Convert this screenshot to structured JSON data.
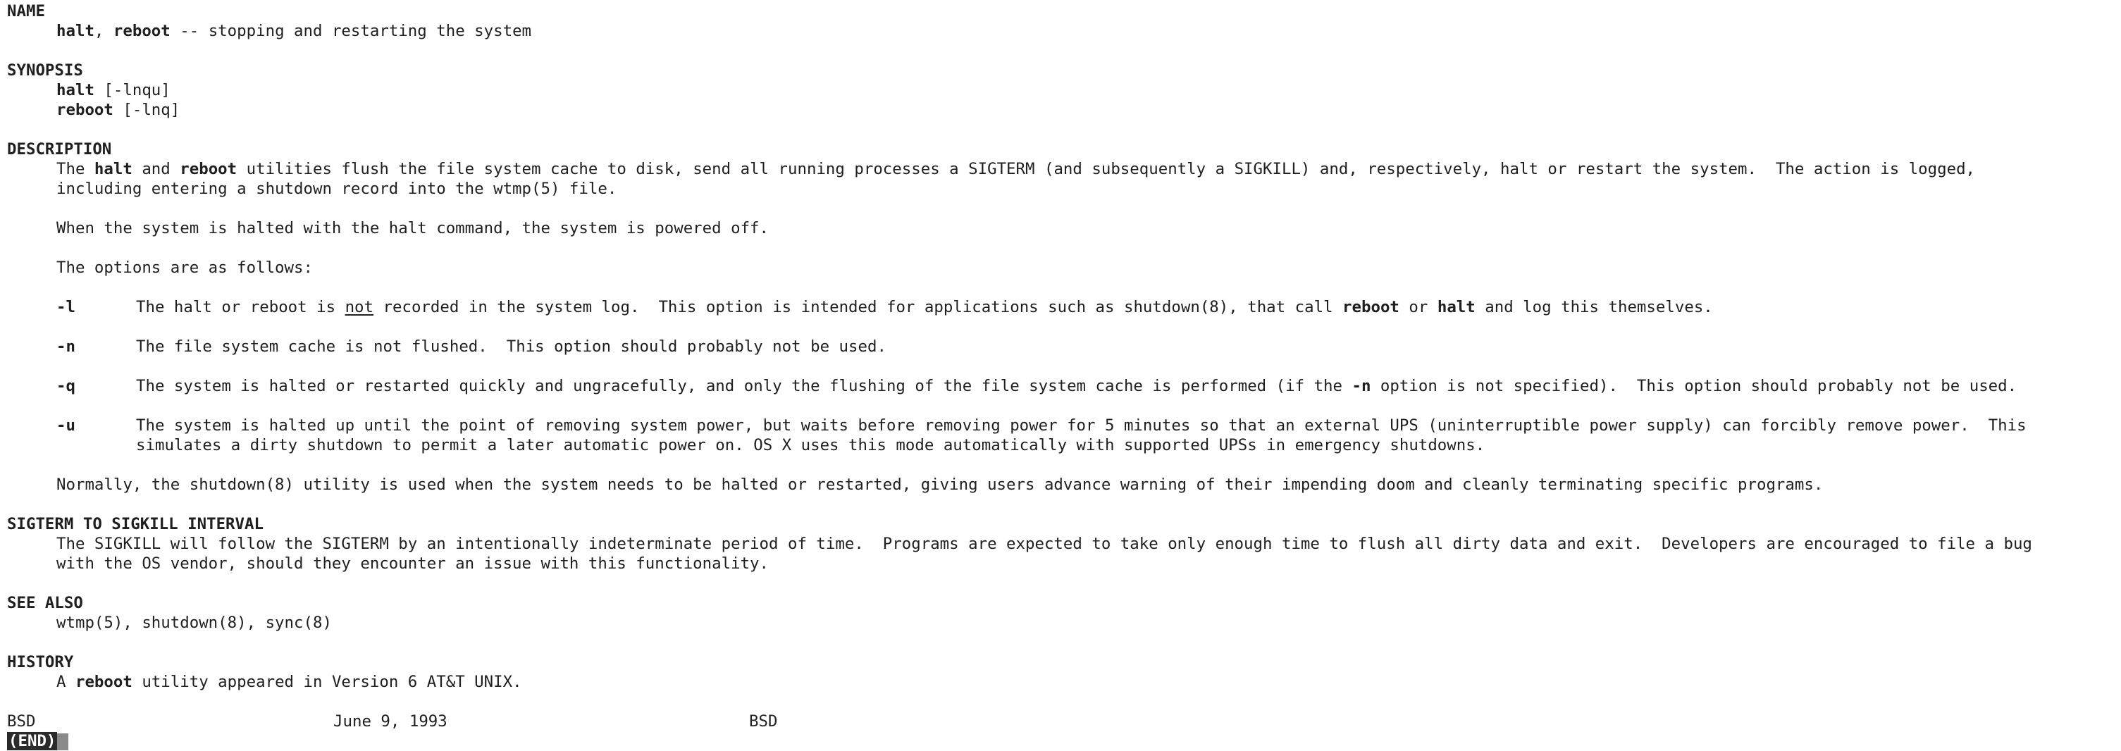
{
  "sections": {
    "name": "NAME",
    "synopsis": "SYNOPSIS",
    "description": "DESCRIPTION",
    "interval": "SIGTERM TO SIGKILL INTERVAL",
    "see_also": "SEE ALSO",
    "history": "HISTORY"
  },
  "name": {
    "cmd1": "halt",
    "sep": ", ",
    "cmd2": "reboot",
    "desc": " -- stopping and restarting the system"
  },
  "synopsis": {
    "halt_cmd": "halt",
    "halt_args": " [-lnqu]",
    "reboot_cmd": "reboot",
    "reboot_args": " [-lnq]"
  },
  "description": {
    "p1_a": "The ",
    "p1_halt": "halt",
    "p1_b": " and ",
    "p1_reboot": "reboot",
    "p1_c": " utilities flush the file system cache to disk, send all running processes a SIGTERM (and subsequently a SIGKILL) and, respectively, halt or restart the system.  The action is logged,",
    "p1_line2": "including entering a shutdown record into the wtmp(5) file.",
    "p2": "When the system is halted with the halt command, the system is powered off.",
    "p3": "The options are as follows:",
    "opt_l_flag": "-l",
    "opt_l_a": "The halt or reboot is ",
    "opt_l_not": "not",
    "opt_l_b": " recorded in the system log.  This option is intended for applications such as shutdown(8), that call ",
    "opt_l_reboot": "reboot",
    "opt_l_c": " or ",
    "opt_l_halt": "halt",
    "opt_l_d": " and log this themselves.",
    "opt_n_flag": "-n",
    "opt_n_text": "The file system cache is not flushed.  This option should probably not be used.",
    "opt_q_flag": "-q",
    "opt_q_a": "The system is halted or restarted quickly and ungracefully, and only the flushing of the file system cache is performed (if the ",
    "opt_q_n": "-n",
    "opt_q_b": " option is not specified).  This option should probably not be used.",
    "opt_u_flag": "-u",
    "opt_u_line1": "The system is halted up until the point of removing system power, but waits before removing power for 5 minutes so that an external UPS (uninterruptible power supply) can forcibly remove power.  This",
    "opt_u_line2": "simulates a dirty shutdown to permit a later automatic power on. OS X uses this mode automatically with supported UPSs in emergency shutdowns.",
    "p4": "Normally, the shutdown(8) utility is used when the system needs to be halted or restarted, giving users advance warning of their impending doom and cleanly terminating specific programs."
  },
  "interval": {
    "line1": "The SIGKILL will follow the SIGTERM by an intentionally indeterminate period of time.  Programs are expected to take only enough time to flush all dirty data and exit.  Developers are encouraged to file a bug",
    "line2": "with the OS vendor, should they encounter an issue with this functionality."
  },
  "see_also": {
    "refs": "wtmp(5), shutdown(8), sync(8)"
  },
  "history": {
    "a": "A ",
    "reboot": "reboot",
    "b": " utility appeared in Version 6 AT&T UNIX."
  },
  "footer": {
    "left": "BSD",
    "date": "June 9, 1993",
    "right": "BSD"
  },
  "pager": {
    "status": "(END)"
  },
  "colors": {
    "background": "#ffffff",
    "text": "#1f1f1f",
    "status_bg": "#2b2b2b",
    "cursor": "#8a8a8a"
  }
}
